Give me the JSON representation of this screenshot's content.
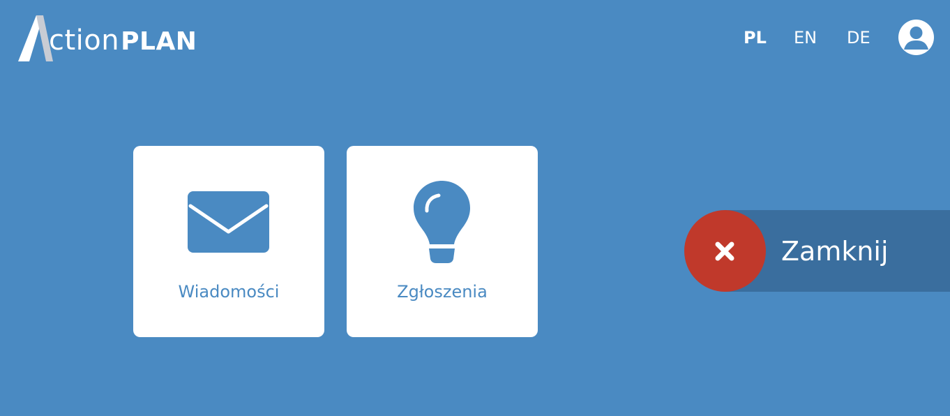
{
  "theme": {
    "background": "#4a8ac2",
    "tile_background": "#ffffff",
    "tile_accent": "#4a8ac2",
    "close_bar": "#3a6e9e",
    "close_circle": "#c0392b"
  },
  "header": {
    "logo": {
      "light": "ction",
      "bold": "PLAN",
      "icon": "letter-a-icon"
    },
    "languages": [
      {
        "code": "PL",
        "active": true
      },
      {
        "code": "EN",
        "active": false
      },
      {
        "code": "DE",
        "active": false
      }
    ],
    "user_icon": "user-icon"
  },
  "tiles": [
    {
      "label": "Wiadomości",
      "icon": "envelope-icon"
    },
    {
      "label": "Zgłoszenia",
      "icon": "lightbulb-icon"
    }
  ],
  "close_button": {
    "label": "Zamknij",
    "icon": "close-icon"
  }
}
